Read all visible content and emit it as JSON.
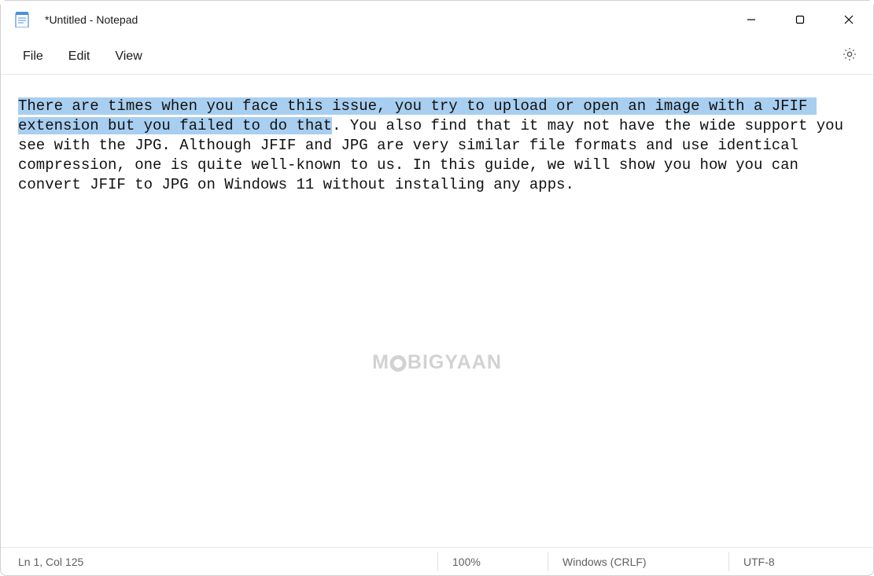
{
  "titlebar": {
    "title": "*Untitled - Notepad"
  },
  "menubar": {
    "file": "File",
    "edit": "Edit",
    "view": "View"
  },
  "editor": {
    "selected_text": "There are times when you face this issue, you try to upload or open an image with a JFIF extension but you failed to do that",
    "rest_text": ". You also find that it may not have the wide support you see with the JPG. Although JFIF and JPG are very similar file formats and use identical compression, one is quite well-known to us. In this guide, we will show you how you can convert JFIF to JPG on Windows 11 without installing any apps."
  },
  "watermark": {
    "left": "M",
    "right": "BIGYAAN"
  },
  "statusbar": {
    "position": "Ln 1, Col 125",
    "zoom": "100%",
    "line_ending": "Windows (CRLF)",
    "encoding": "UTF-8"
  }
}
